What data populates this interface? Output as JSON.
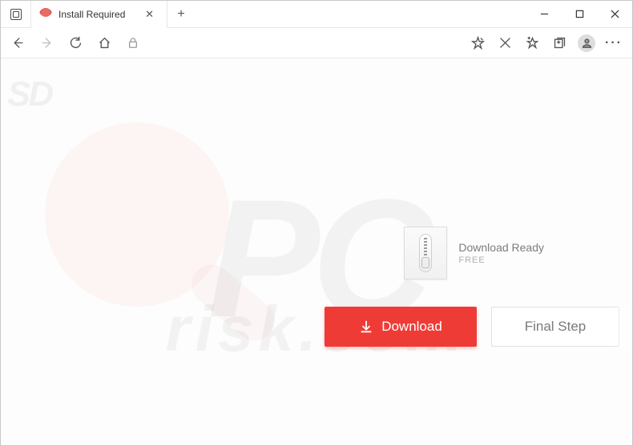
{
  "browser": {
    "tab_title": "Install Required",
    "new_tab_label": "+",
    "tab_close_label": "✕"
  },
  "window_controls": {
    "minimize": "minimize",
    "maximize": "maximize",
    "close": "close"
  },
  "watermarks": {
    "sd": "SD",
    "pc": "PC",
    "risk": "risk.com"
  },
  "file": {
    "title": "Download Ready",
    "subtitle": "FREE"
  },
  "buttons": {
    "download": "Download",
    "final_step": "Final Step"
  }
}
